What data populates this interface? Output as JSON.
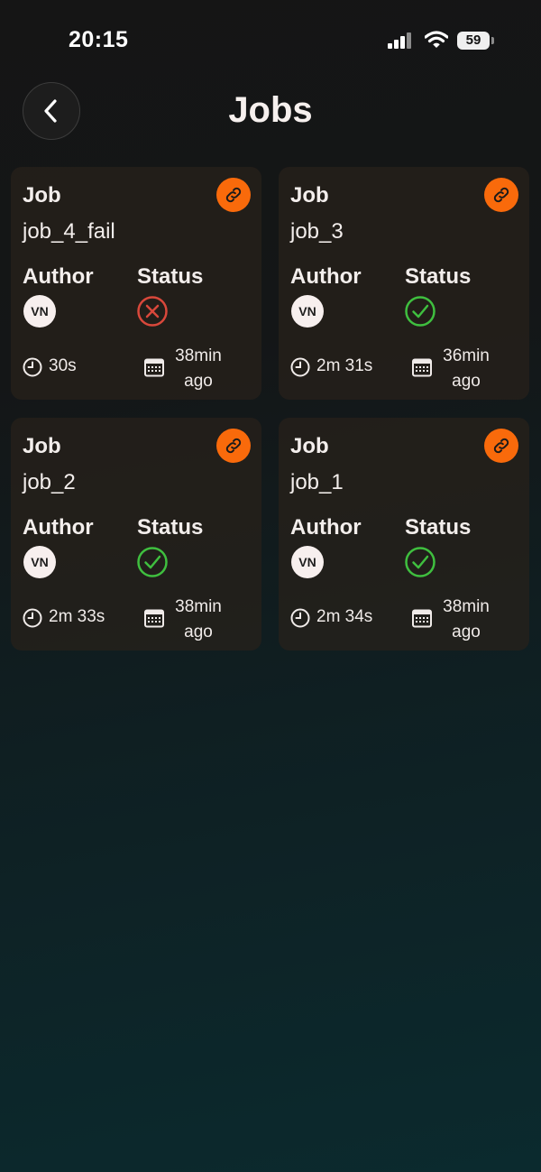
{
  "status_bar": {
    "time": "20:15",
    "battery": "59",
    "icons": [
      "signal-icon",
      "wifi-icon",
      "battery-icon"
    ]
  },
  "header": {
    "title": "Jobs",
    "back_icon": "chevron-left-icon"
  },
  "labels": {
    "job": "Job",
    "author": "Author",
    "status": "Status"
  },
  "colors": {
    "accent": "#f96a0b",
    "success": "#3fbf3f",
    "failure": "#d9483b"
  },
  "jobs": [
    {
      "name": "job_4_fail",
      "author": "VN",
      "status": "failed",
      "duration": "30s",
      "time_ago_line1": "38min",
      "time_ago_line2": "ago"
    },
    {
      "name": "job_3",
      "author": "VN",
      "status": "success",
      "duration": "2m 31s",
      "time_ago_line1": "36min",
      "time_ago_line2": "ago"
    },
    {
      "name": "job_2",
      "author": "VN",
      "status": "success",
      "duration": "2m 33s",
      "time_ago_line1": "38min",
      "time_ago_line2": "ago"
    },
    {
      "name": "job_1",
      "author": "VN",
      "status": "success",
      "duration": "2m 34s",
      "time_ago_line1": "38min",
      "time_ago_line2": "ago"
    }
  ]
}
